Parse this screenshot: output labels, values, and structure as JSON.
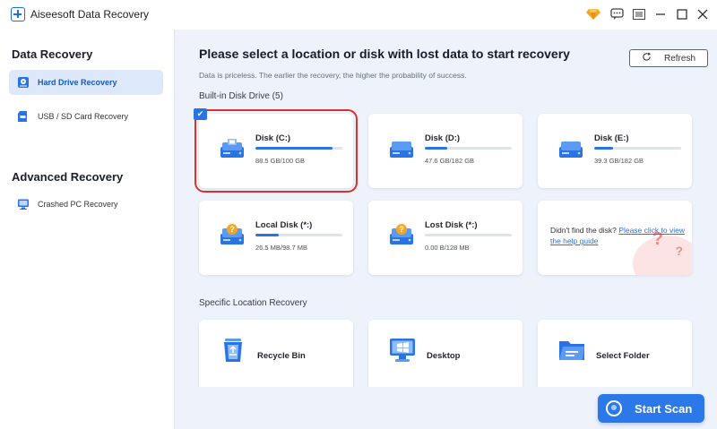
{
  "app": {
    "title": "Aiseesoft Data Recovery"
  },
  "titlebar": {
    "icons": [
      "premium-icon",
      "feedback-icon",
      "menu-icon",
      "minimize-icon",
      "maximize-icon",
      "close-icon"
    ]
  },
  "sidebar": {
    "data_recovery_title": "Data Recovery",
    "items": [
      {
        "label": "Hard Drive Recovery",
        "active": true,
        "icon": "hard-drive-icon"
      },
      {
        "label": "USB / SD Card Recovery",
        "active": false,
        "icon": "sd-card-icon"
      }
    ],
    "advanced_title": "Advanced Recovery",
    "advanced_items": [
      {
        "label": "Crashed PC Recovery",
        "icon": "crashed-pc-icon"
      }
    ]
  },
  "main": {
    "title": "Please select a location or disk with lost data to start recovery",
    "subtitle": "Data is priceless. The earlier the recovery, the higher the probability of success.",
    "refresh_label": "Refresh",
    "builtin_label": "Built-in Disk Drive (5)",
    "disks": [
      {
        "name": "Disk (C:)",
        "size": "88.5 GB/100 GB",
        "fill": 0.885,
        "selected": true,
        "type": "system"
      },
      {
        "name": "Disk (D:)",
        "size": "47.6 GB/182 GB",
        "fill": 0.26,
        "selected": false,
        "type": "normal"
      },
      {
        "name": "Disk (E:)",
        "size": "39.3 GB/182 GB",
        "fill": 0.22,
        "selected": false,
        "type": "normal"
      },
      {
        "name": "Local Disk (*:)",
        "size": "26.5 MB/98.7 MB",
        "fill": 0.27,
        "selected": false,
        "type": "unknown"
      },
      {
        "name": "Lost Disk (*:)",
        "size": "0.00  B/128 MB",
        "fill": 0.0,
        "selected": false,
        "type": "unknown"
      }
    ],
    "help": {
      "prefix": "Didn't find the disk? ",
      "link": "Please click to view the help guide"
    },
    "specific_label": "Specific Location Recovery",
    "locations": [
      {
        "label": "Recycle Bin",
        "icon": "recycle-bin-icon"
      },
      {
        "label": "Desktop",
        "icon": "desktop-icon"
      },
      {
        "label": "Select Folder",
        "icon": "folder-icon"
      }
    ],
    "start_scan": "Start Scan"
  },
  "colors": {
    "accent": "#2a73e4",
    "selection": "#d9312e",
    "background": "#eef3fb"
  }
}
